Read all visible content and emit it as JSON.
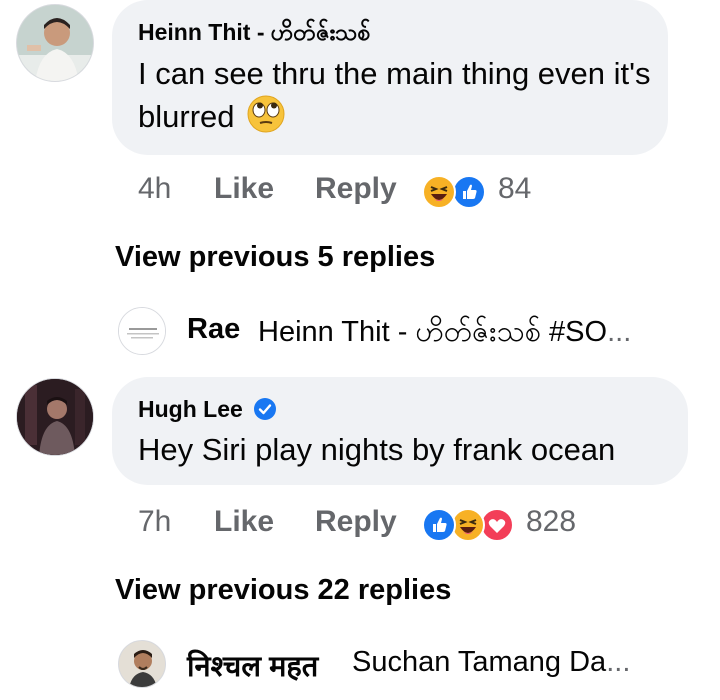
{
  "comments": [
    {
      "author": "Heinn Thit - ဟိတ်ဇ်းသစ်",
      "text": "I can see thru the main thing even it's blurred",
      "emoji_icon": "face-with-rolling-eyes-icon",
      "time": "4h",
      "like_label": "Like",
      "reply_label": "Reply",
      "reactions": [
        "haha-icon",
        "like-icon"
      ],
      "reaction_count": "84",
      "view_previous": "View previous 5 replies",
      "reply_preview": {
        "author": "Rae",
        "text": "Heinn Thit - ဟိတ်ဇ်းသစ် #SO",
        "ellipsis": "..."
      }
    },
    {
      "author": "Hugh Lee",
      "verified_icon": "verified-badge-icon",
      "text": "Hey Siri play nights by frank ocean",
      "time": "7h",
      "like_label": "Like",
      "reply_label": "Reply",
      "reactions": [
        "like-icon",
        "haha-icon",
        "love-icon"
      ],
      "reaction_count": "828",
      "view_previous": "View previous 22 replies",
      "reply_preview": {
        "author": "निश्चल महत",
        "text": "Suchan Tamang Da",
        "ellipsis": "..."
      }
    }
  ],
  "colors": {
    "bubble": "#f0f2f5",
    "meta": "#65676b",
    "like_blue": "#1877f2",
    "love_red": "#f33e58",
    "haha_yellow": "#f7b125"
  }
}
